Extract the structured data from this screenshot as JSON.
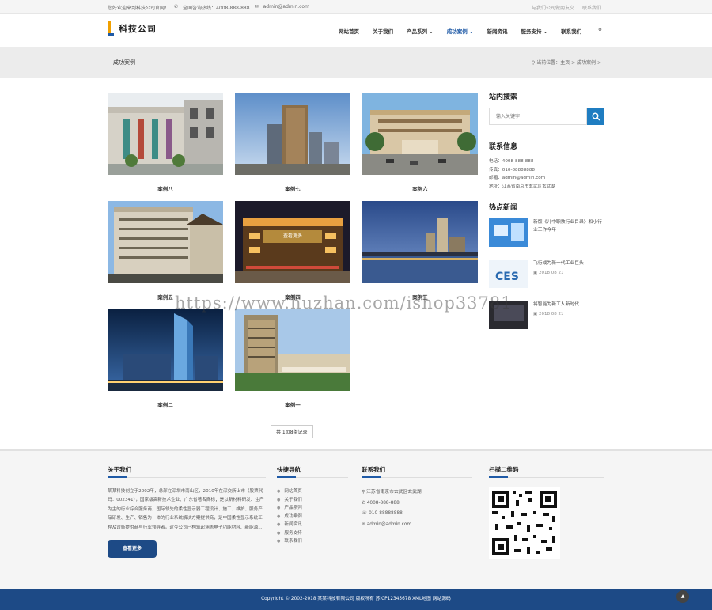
{
  "topbar": {
    "welcome": "您好欢迎来到科技公司官网！",
    "hotline_label": "全国咨询热线：",
    "hotline": "4008-888-888",
    "email": "admin@admin.com",
    "right_links": [
      "与我们公司做朋友交",
      "联系我们"
    ]
  },
  "logo": {
    "text": "科技公司"
  },
  "nav": {
    "items": [
      "网站首页",
      "关于我们",
      "产品系列",
      "成功案例",
      "新闻资讯",
      "服务支持",
      "联系我们"
    ],
    "active": "成功案例"
  },
  "banner": {
    "title": "成功案例",
    "crumb": "当前位置：主页 > 成功案例 >"
  },
  "cases": [
    {
      "title": "案例八"
    },
    {
      "title": "案例七"
    },
    {
      "title": "案例六"
    },
    {
      "title": "案例五"
    },
    {
      "title": "案例四",
      "tag": "查看更多"
    },
    {
      "title": "案例三"
    },
    {
      "title": "案例二"
    },
    {
      "title": "案例一"
    }
  ],
  "pager": {
    "text": "共 1页8条记录"
  },
  "sidebar": {
    "search_title": "站内搜索",
    "search_placeholder": "输入关键字",
    "contact_title": "联系信息",
    "contact_lines": [
      "电话：4008-888-888",
      "传真：010-88888888",
      "邮箱：admin@admin.com",
      "地址：江苏省南京市玄武区玄武湖"
    ],
    "news_title": "热点新闻",
    "news": [
      {
        "title": "新版《儿中职教行业目录》和小行业工作今年",
        "date": ""
      },
      {
        "title": "飞行成为新一代工业巨头",
        "date": "2018 08 21"
      },
      {
        "title": "将智能为新工人新时代",
        "date": "2018 08 21"
      }
    ]
  },
  "footer": {
    "about_title": "关于我们",
    "about_text": "某某科技创立于2002年，总部在深圳市南山区，2010年在深交所上市（股票代码：002341），国家级高新技术企业、广东省著名商标；是以新材料研发、生产为主的行业综合服务商，国际领先的柔性显示器工程设计、施工、维护、服务产品研发、生产、销售为一体的行业系统解决方案提供商，是中国柔性显示系统工程及设备提供商与行业领导者。近今公司已构筑起涵盖电子功能材料、新能源...",
    "more_label": "查看更多",
    "quick_title": "快捷导航",
    "quick_links": [
      "网站首页",
      "关于我们",
      "产品系列",
      "成功案例",
      "新闻资讯",
      "服务支持",
      "联系我们"
    ],
    "contact_title": "联系我们",
    "contact": {
      "address": "江苏省南京市玄武区玄武湖",
      "phone": "4008-888-888",
      "fax": "010-88888888",
      "email": "admin@admin.com"
    },
    "qr_title": "扫描二维码"
  },
  "copyright": "Copyright © 2002-2018 某某科技有限公司 版权所有 苏ICP12345678 XML地图 网站源码",
  "watermark": "https://www.huzhan.com/ishop33781"
}
